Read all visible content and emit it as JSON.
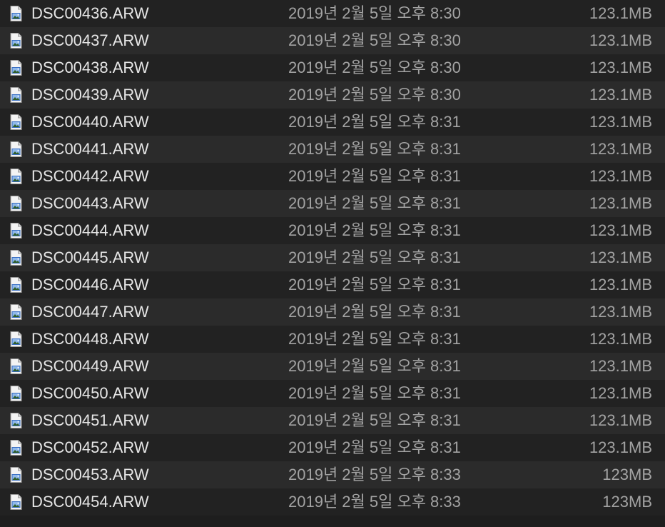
{
  "file_list": {
    "rows": [
      {
        "name": "DSC00436.ARW",
        "modified": "2019년 2월 5일 오후 8:30",
        "size": "123.1MB",
        "icon": "raw-image-file-icon"
      },
      {
        "name": "DSC00437.ARW",
        "modified": "2019년 2월 5일 오후 8:30",
        "size": "123.1MB",
        "icon": "raw-image-file-icon"
      },
      {
        "name": "DSC00438.ARW",
        "modified": "2019년 2월 5일 오후 8:30",
        "size": "123.1MB",
        "icon": "raw-image-file-icon"
      },
      {
        "name": "DSC00439.ARW",
        "modified": "2019년 2월 5일 오후 8:30",
        "size": "123.1MB",
        "icon": "raw-image-file-icon"
      },
      {
        "name": "DSC00440.ARW",
        "modified": "2019년 2월 5일 오후 8:31",
        "size": "123.1MB",
        "icon": "raw-image-file-icon"
      },
      {
        "name": "DSC00441.ARW",
        "modified": "2019년 2월 5일 오후 8:31",
        "size": "123.1MB",
        "icon": "raw-image-file-icon"
      },
      {
        "name": "DSC00442.ARW",
        "modified": "2019년 2월 5일 오후 8:31",
        "size": "123.1MB",
        "icon": "raw-image-file-icon"
      },
      {
        "name": "DSC00443.ARW",
        "modified": "2019년 2월 5일 오후 8:31",
        "size": "123.1MB",
        "icon": "raw-image-file-icon"
      },
      {
        "name": "DSC00444.ARW",
        "modified": "2019년 2월 5일 오후 8:31",
        "size": "123.1MB",
        "icon": "raw-image-file-icon"
      },
      {
        "name": "DSC00445.ARW",
        "modified": "2019년 2월 5일 오후 8:31",
        "size": "123.1MB",
        "icon": "raw-image-file-icon"
      },
      {
        "name": "DSC00446.ARW",
        "modified": "2019년 2월 5일 오후 8:31",
        "size": "123.1MB",
        "icon": "raw-image-file-icon"
      },
      {
        "name": "DSC00447.ARW",
        "modified": "2019년 2월 5일 오후 8:31",
        "size": "123.1MB",
        "icon": "raw-image-file-icon"
      },
      {
        "name": "DSC00448.ARW",
        "modified": "2019년 2월 5일 오후 8:31",
        "size": "123.1MB",
        "icon": "raw-image-file-icon"
      },
      {
        "name": "DSC00449.ARW",
        "modified": "2019년 2월 5일 오후 8:31",
        "size": "123.1MB",
        "icon": "raw-image-file-icon"
      },
      {
        "name": "DSC00450.ARW",
        "modified": "2019년 2월 5일 오후 8:31",
        "size": "123.1MB",
        "icon": "raw-image-file-icon"
      },
      {
        "name": "DSC00451.ARW",
        "modified": "2019년 2월 5일 오후 8:31",
        "size": "123.1MB",
        "icon": "raw-image-file-icon"
      },
      {
        "name": "DSC00452.ARW",
        "modified": "2019년 2월 5일 오후 8:31",
        "size": "123.1MB",
        "icon": "raw-image-file-icon"
      },
      {
        "name": "DSC00453.ARW",
        "modified": "2019년 2월 5일 오후 8:33",
        "size": "123MB",
        "icon": "raw-image-file-icon"
      },
      {
        "name": "DSC00454.ARW",
        "modified": "2019년 2월 5일 오후 8:33",
        "size": "123MB",
        "icon": "raw-image-file-icon"
      }
    ]
  }
}
